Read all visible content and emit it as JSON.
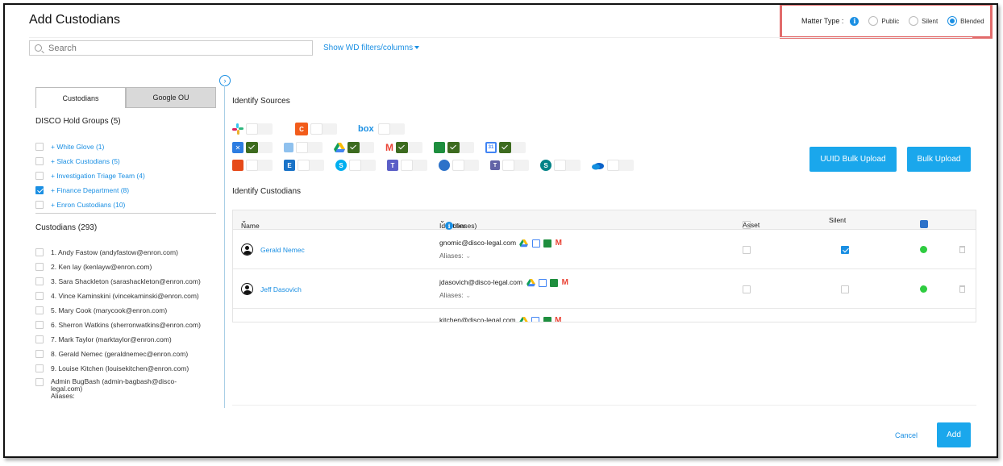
{
  "title": "Add Custodians",
  "matter_type": {
    "label": "Matter Type :",
    "options": [
      "Public",
      "Silent",
      "Blended"
    ],
    "selected": "Blended"
  },
  "search": {
    "placeholder": "Search"
  },
  "filters_link": "Show WD filters/columns",
  "tabs": [
    "Custodians",
    "Google OU"
  ],
  "hold_groups": {
    "heading": "DISCO Hold Groups (5)",
    "items": [
      {
        "label": "+ White Glove (1)",
        "checked": false
      },
      {
        "label": "+ Slack Custodians (5)",
        "checked": false
      },
      {
        "label": "+ Investigation Triage Team (4)",
        "checked": false
      },
      {
        "label": "+ Finance Department (8)",
        "checked": true
      },
      {
        "label": "+ Enron Custodians (10)",
        "checked": false
      }
    ]
  },
  "custodians": {
    "heading": "Custodians (293)",
    "items": [
      "1. Andy Fastow (andyfastow@enron.com)",
      "2. Ken lay (kenlayw@enron.com)",
      "3. Sara Shackleton (sarashackleton@enron.com)",
      "4. Vince Kaminskini (vincekaminski@enron.com)",
      "5. Mary Cook (marycook@enron.com)",
      "6. Sherron Watkins (sherronwatkins@enron.com)",
      "7. Mark Taylor (marktaylor@enron.com)",
      "8. Gerald Nemec (geraldnemec@enron.com)",
      "9. Louise Kitchen (louisekitchen@enron.com)"
    ],
    "last_item": "Admin BugBash (admin-bagbash@disco-legal.com)",
    "last_aliases": "Aliases:"
  },
  "identify_sources": "Identify Sources",
  "identify_custodians": "Identify Custodians",
  "buttons": {
    "uuid_bulk": "UUID Bulk Upload",
    "bulk": "Bulk Upload",
    "cancel": "Cancel",
    "add": "Add"
  },
  "table": {
    "col_name": "Name",
    "col_identifier": "Identifier",
    "col_licenses": "(Licenses)",
    "col_asset": "Asset",
    "col_silent": "Silent",
    "rows": [
      {
        "name": "Gerald Nemec",
        "identifier": "gnomic@disco-legal.com",
        "aliases": "Aliases:",
        "silent": true
      },
      {
        "name": "Jeff Dasovich",
        "identifier": "jdasovich@disco-legal.com",
        "aliases": "Aliases:",
        "silent": false
      },
      {
        "name": "",
        "identifier": "kitchen@disco-legal.com",
        "aliases": "",
        "silent": false
      }
    ]
  },
  "colors": {
    "accent": "#1a8fe3",
    "button": "#1aa7ec",
    "highlight": "#e26b6b",
    "toggle_on": "#3d6b1f",
    "status": "#2ecc40"
  },
  "icons": [
    "slack-icon",
    "clickup-icon",
    "box-icon",
    "jira-icon",
    "chat-icon",
    "google-drive-icon",
    "gmail-icon",
    "google-chat-icon",
    "google-calendar-icon",
    "office-icon",
    "exchange-icon",
    "skype-icon",
    "teams-icon",
    "yammer-icon",
    "teams-alt-icon",
    "sharepoint-icon",
    "onedrive-icon"
  ]
}
